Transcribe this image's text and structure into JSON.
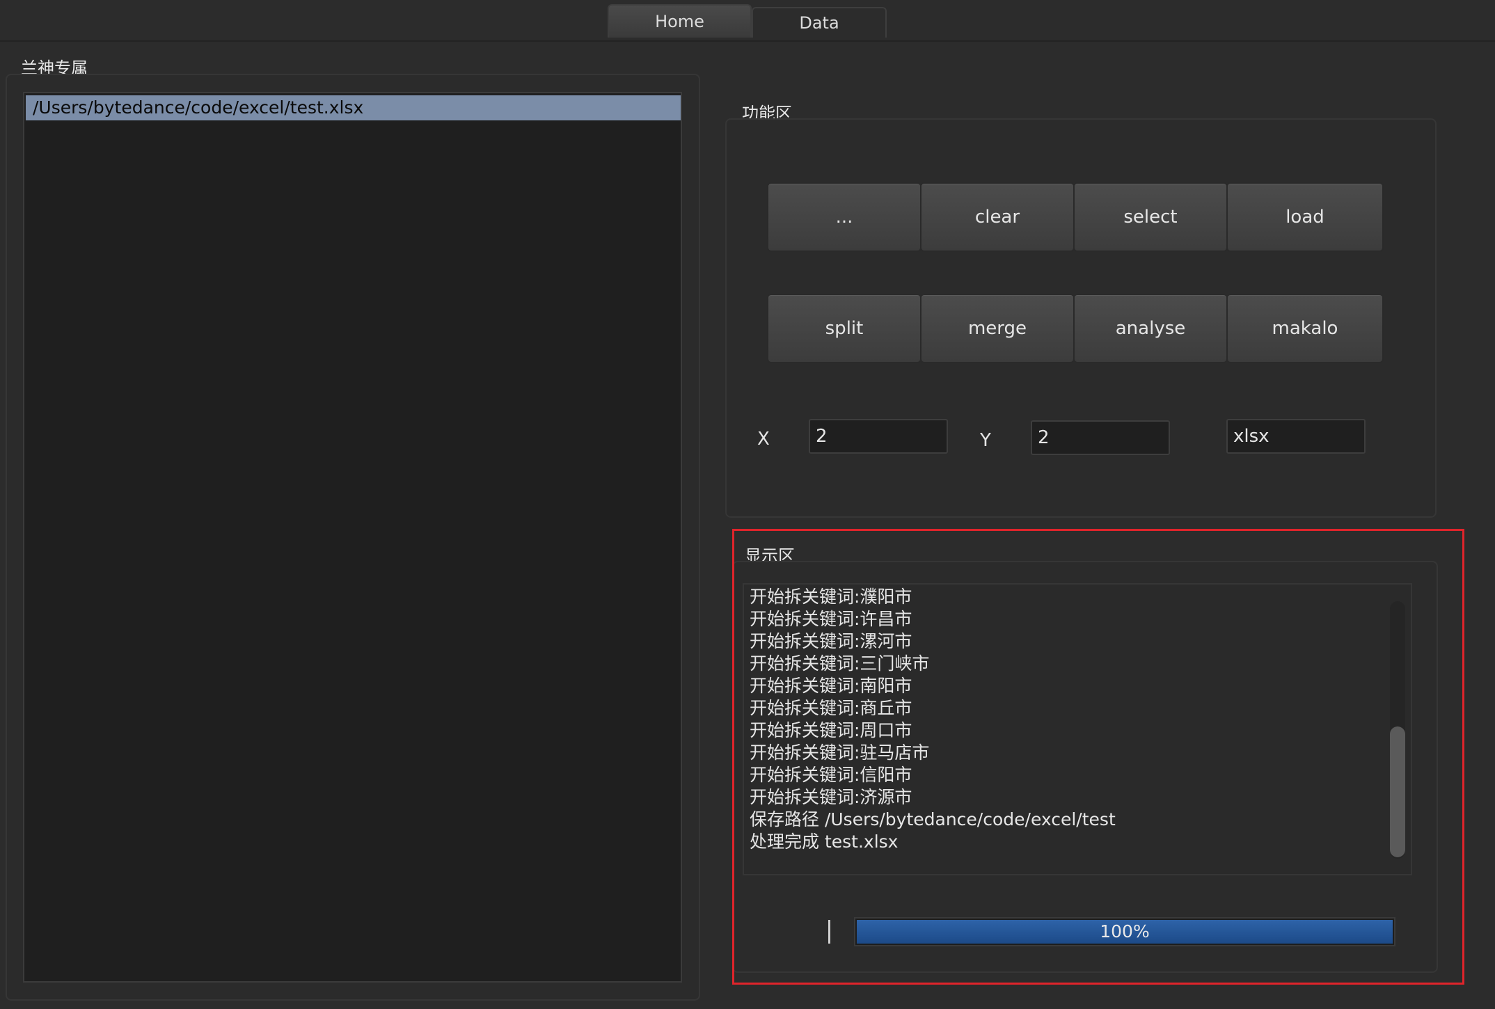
{
  "tabs": [
    {
      "label": "Home",
      "active": true
    },
    {
      "label": "Data",
      "active": false
    }
  ],
  "left_panel": {
    "title": "兰神专属",
    "files": [
      "/Users/bytedance/code/excel/test.xlsx"
    ]
  },
  "function_area": {
    "title": "功能区",
    "buttons_row1": [
      "...",
      "clear",
      "select",
      "load"
    ],
    "buttons_row2": [
      "split",
      "merge",
      "analyse",
      "makalo"
    ],
    "x_label": "X",
    "x_value": "2",
    "y_label": "Y",
    "y_value": "2",
    "format_value": "xlsx"
  },
  "display_area": {
    "title": "显示区",
    "log_lines": [
      "开始拆关键词:濮阳市",
      "开始拆关键词:许昌市",
      "开始拆关键词:漯河市",
      "开始拆关键词:三门峡市",
      "开始拆关键词:南阳市",
      "开始拆关键词:商丘市",
      "开始拆关键词:周口市",
      "开始拆关键词:驻马店市",
      "开始拆关键词:信阳市",
      "开始拆关键词:济源市",
      "保存路径 /Users/bytedance/code/excel/test",
      "处理完成 test.xlsx"
    ],
    "progress_value": 1.0,
    "progress_text": "100%"
  },
  "colors": {
    "progress": "#2e63a8",
    "highlight_border": "#e0242b",
    "selection": "#7b8da8"
  }
}
